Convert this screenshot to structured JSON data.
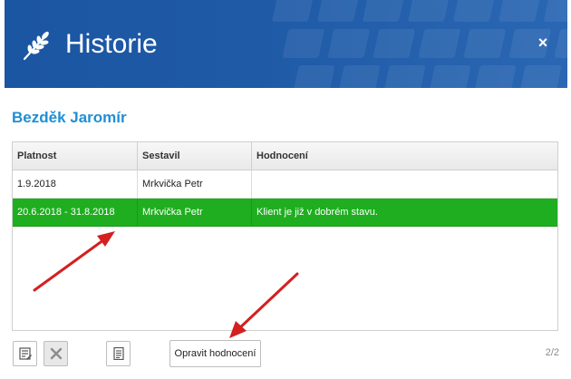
{
  "window": {
    "title": "Historie",
    "close_label": "×"
  },
  "client": {
    "name": "Bezděk Jaromír"
  },
  "table": {
    "columns": [
      "Platnost",
      "Sestavil",
      "Hodnocení"
    ],
    "rows": [
      {
        "platnost": "1.9.2018",
        "sestavil": "Mrkvička Petr",
        "hodnoceni": "",
        "selected": false
      },
      {
        "platnost": "20.6.2018 - 31.8.2018",
        "sestavil": "Mrkvička Petr",
        "hodnoceni": "Klient je již v dobrém stavu.",
        "selected": true
      }
    ]
  },
  "toolbar": {
    "edit_icon": "edit-list-icon",
    "delete_icon": "close-x-icon",
    "document_icon": "document-icon",
    "fix_rating_label": "Opravit hodnocení"
  },
  "pager": {
    "text": "2/2"
  },
  "colors": {
    "header_bg": "#1f5aa6",
    "client_name": "#1e8fd4",
    "selected_row": "#1fae1f",
    "annotation_arrow": "#d42020"
  }
}
